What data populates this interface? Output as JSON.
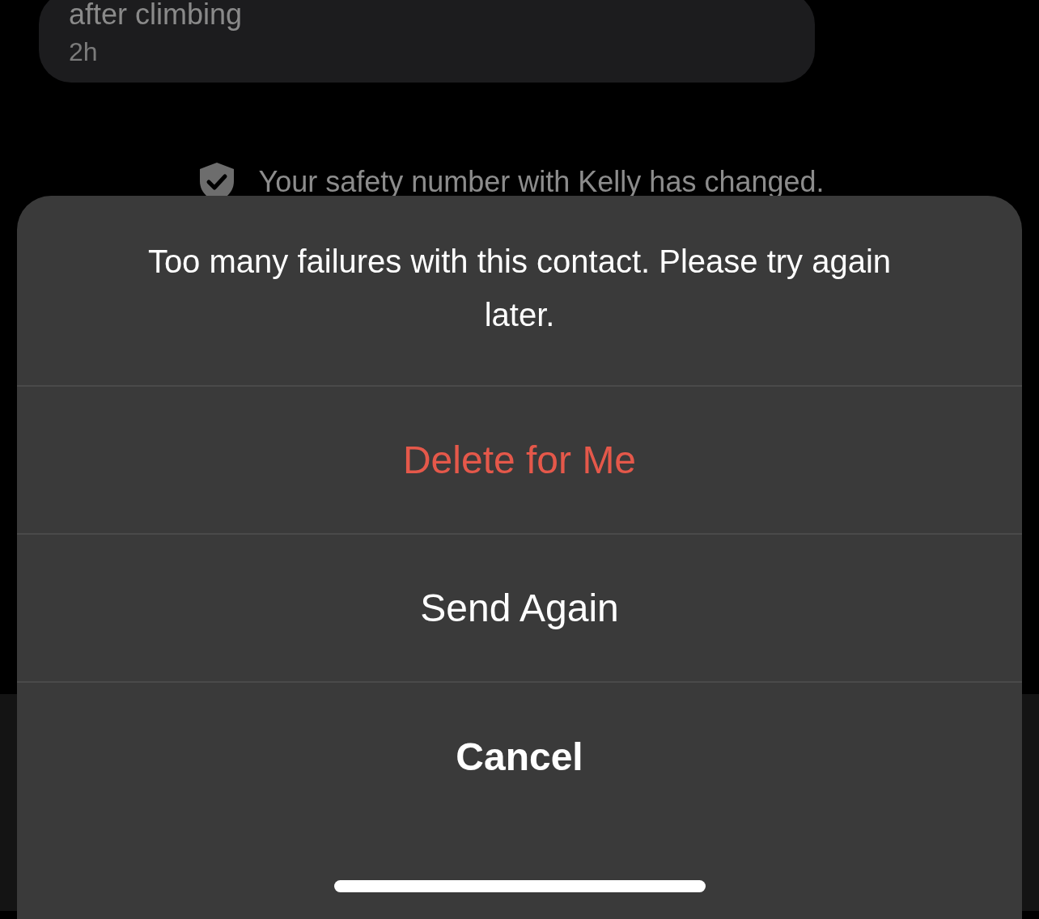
{
  "message": {
    "text": "after climbing",
    "time": "2h"
  },
  "notice": {
    "text": "Your safety number with Kelly has changed."
  },
  "action_sheet": {
    "message": "Too many failures with this contact. Please try again later.",
    "actions": [
      {
        "label": "Delete for Me",
        "kind": "destructive"
      },
      {
        "label": "Send Again",
        "kind": "default"
      },
      {
        "label": "Cancel",
        "kind": "cancel"
      }
    ]
  }
}
